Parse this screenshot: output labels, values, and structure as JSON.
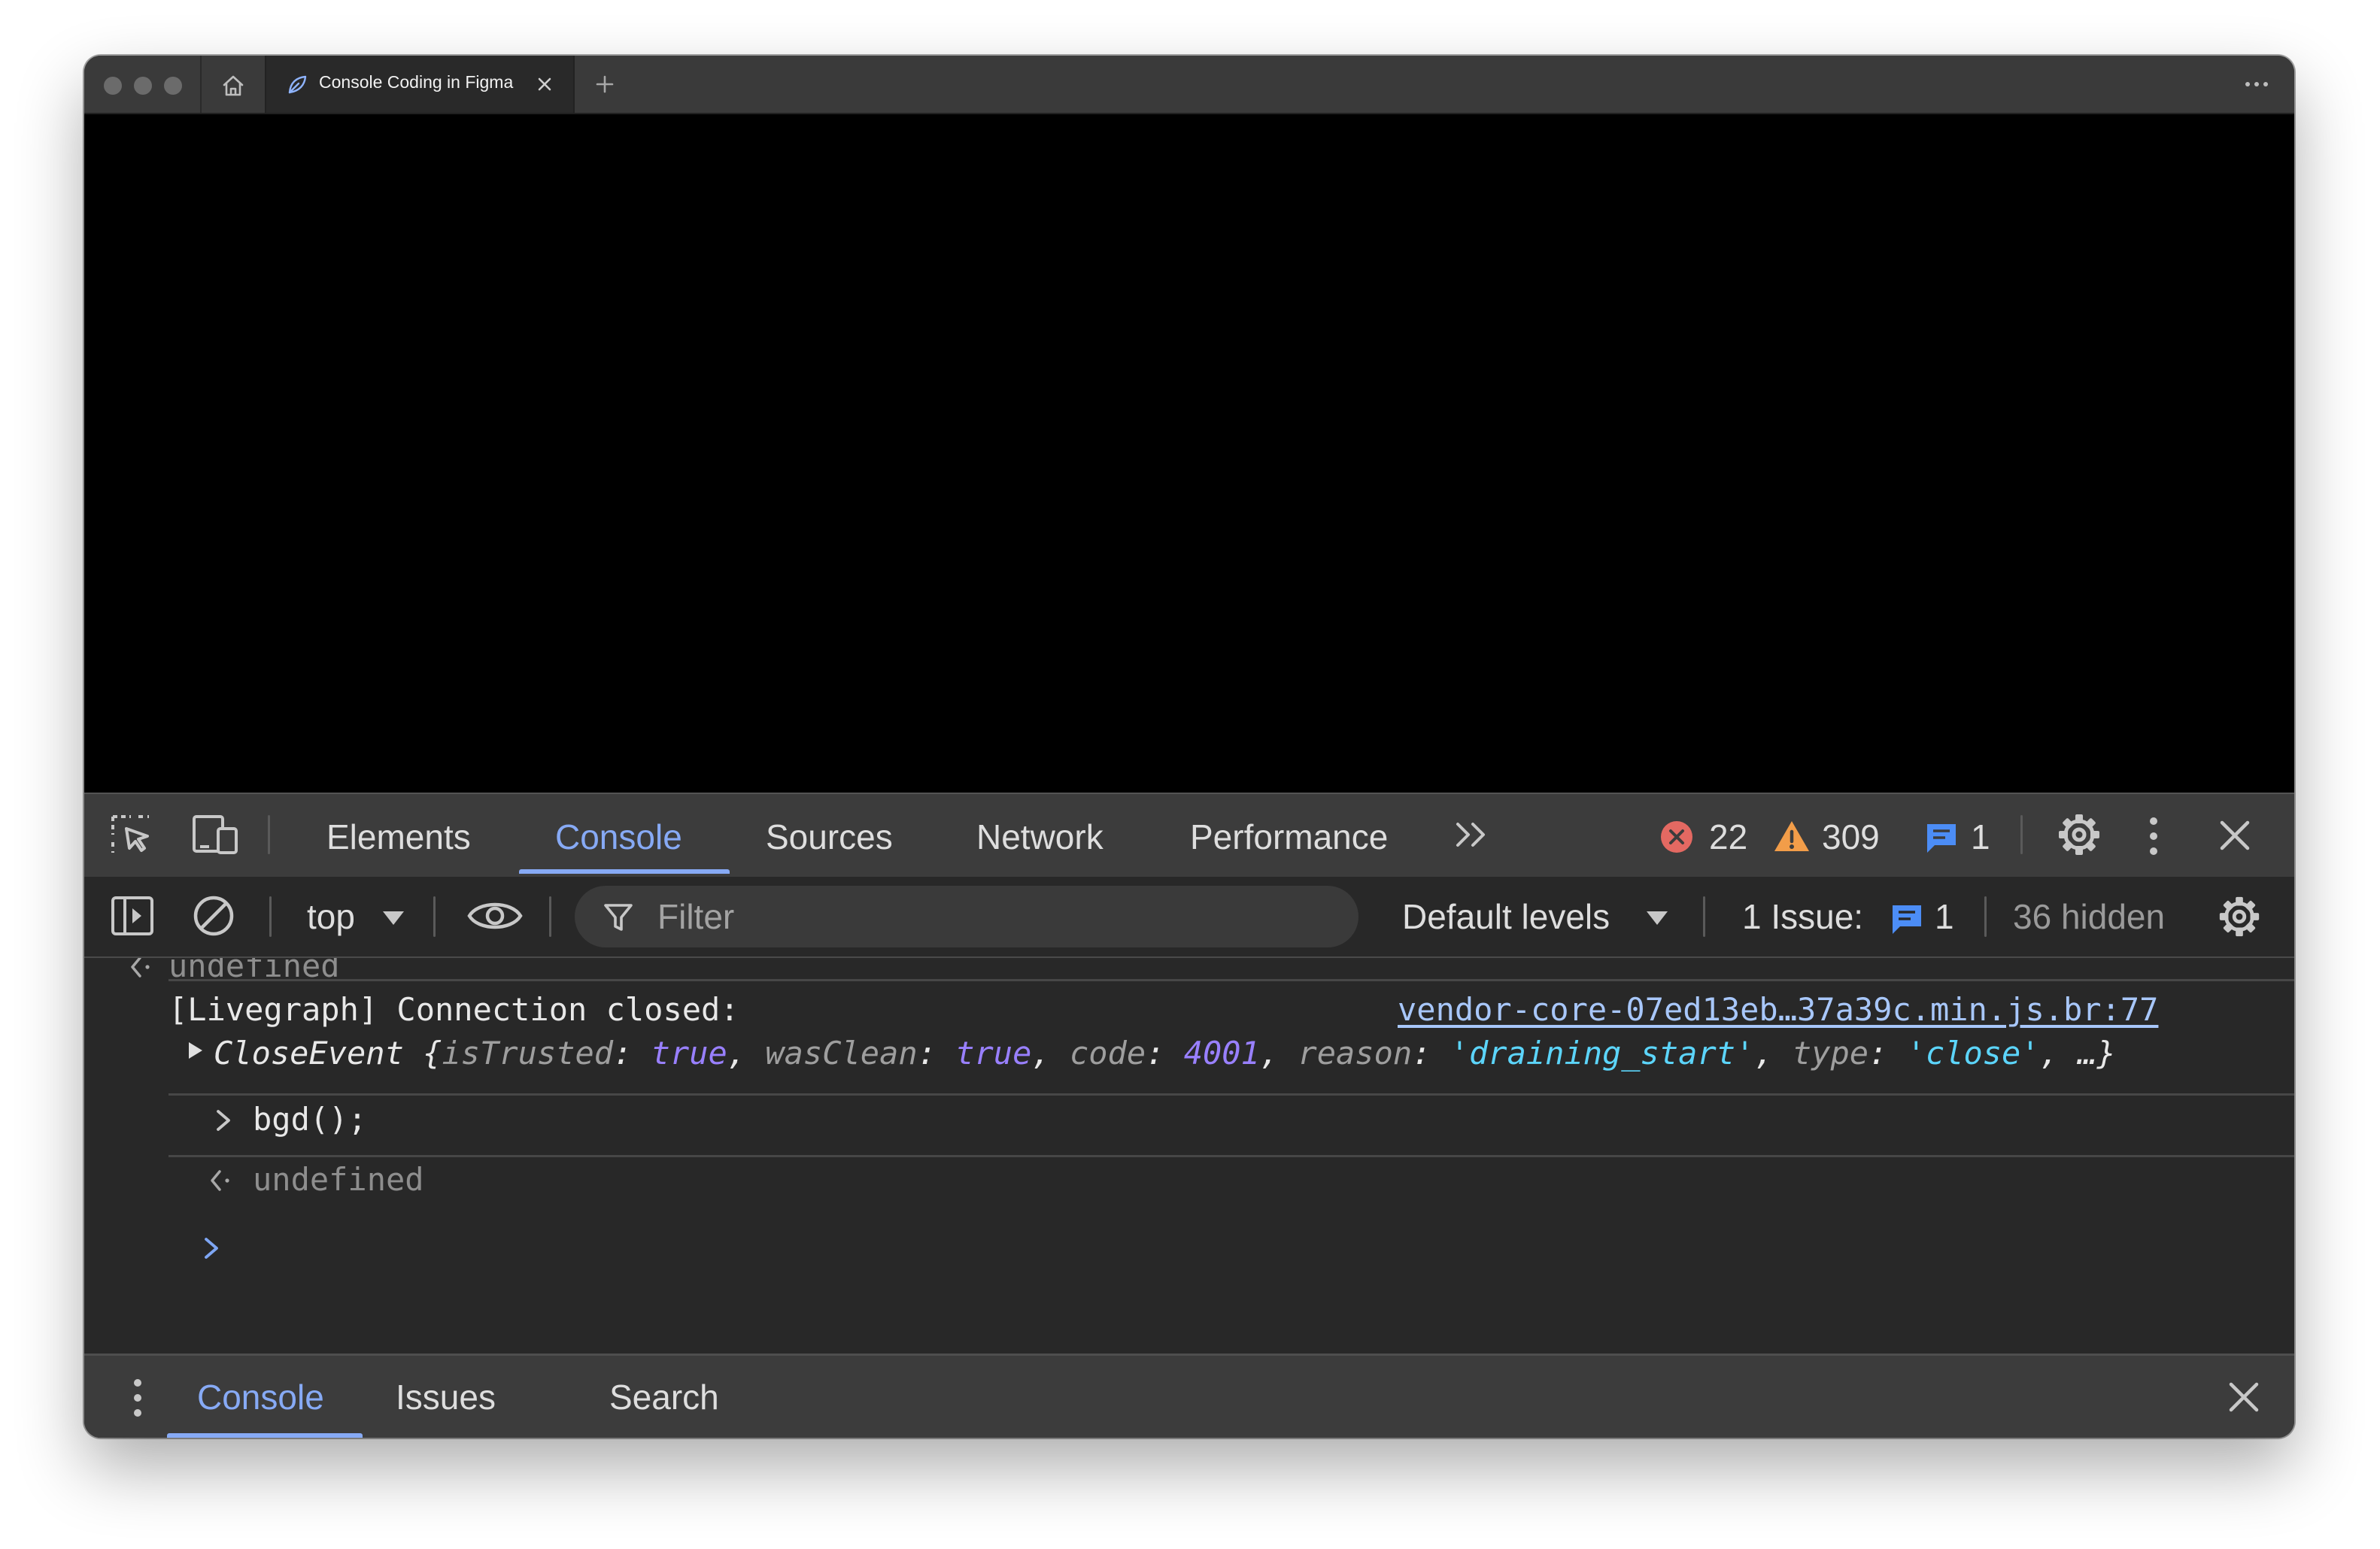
{
  "browser": {
    "tab_title": "Console Coding in Figma",
    "tab_favicon": "figma-leaf-icon"
  },
  "devtools": {
    "main_tabs": [
      "Elements",
      "Console",
      "Sources",
      "Network",
      "Performance"
    ],
    "active_tab": "Console",
    "counts": {
      "errors": "22",
      "warnings": "309",
      "info": "1"
    },
    "toolbar": {
      "context": "top",
      "filter_placeholder": "Filter",
      "levels": "Default levels",
      "issues_label": "1 Issue:",
      "issues_count": "1",
      "hidden": "36 hidden"
    },
    "console": {
      "clipped_result": "undefined",
      "log_message": "[Livegraph] Connection closed:",
      "log_source": "vendor-core-07ed13eb…37a39c.min.js.br:77",
      "event": {
        "class_name": "CloseEvent",
        "open_brace": "{",
        "key_isTrusted": "isTrusted",
        "val_isTrusted": "true",
        "key_wasClean": "wasClean",
        "val_wasClean": "true",
        "key_code": "code",
        "val_code": "4001",
        "key_reason": "reason",
        "val_reason": "'draining_start'",
        "key_type": "type",
        "val_type": "'close'",
        "ellipsis": "…}"
      },
      "input_command": "bgd();",
      "result": "undefined"
    },
    "drawer_tabs": [
      "Console",
      "Issues",
      "Search"
    ],
    "drawer_active": "Console"
  },
  "colors": {
    "accent": "#87aaf5",
    "error": "#e46962",
    "warning": "#f29d49",
    "info": "#4c8df6",
    "string": "#5cd5fb",
    "number_bool": "#9980ff"
  }
}
